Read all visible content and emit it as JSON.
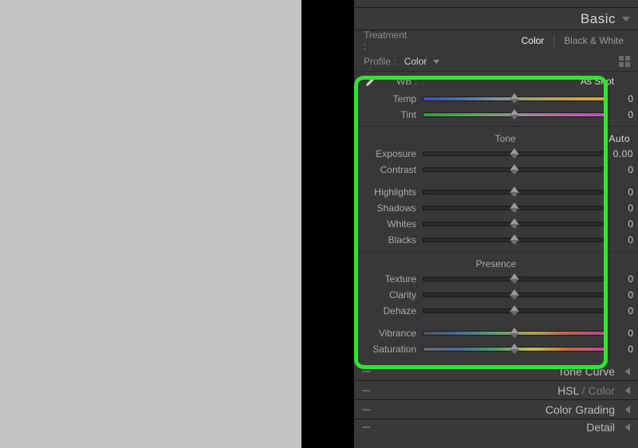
{
  "sections": {
    "basic": "Basic",
    "tone_curve": "Tone Curve",
    "hsl": "HSL",
    "hsl_suffix": " / Color",
    "color_grading": "Color Grading",
    "detail": "Detail"
  },
  "treatment": {
    "label": "Treatment :",
    "color": "Color",
    "bw": "Black & White"
  },
  "profile": {
    "label": "Profile :",
    "value": "Color"
  },
  "wb": {
    "label": "WB :",
    "preset": "As Shot",
    "temp_label": "Temp",
    "tint_label": "Tint",
    "temp_value": "0",
    "tint_value": "0"
  },
  "tone": {
    "title": "Tone",
    "auto": "Auto",
    "exposure_label": "Exposure",
    "exposure_value": "0.00",
    "contrast_label": "Contrast",
    "contrast_value": "0",
    "highlights_label": "Highlights",
    "highlights_value": "0",
    "shadows_label": "Shadows",
    "shadows_value": "0",
    "whites_label": "Whites",
    "whites_value": "0",
    "blacks_label": "Blacks",
    "blacks_value": "0"
  },
  "presence": {
    "title": "Presence",
    "texture_label": "Texture",
    "texture_value": "0",
    "clarity_label": "Clarity",
    "clarity_value": "0",
    "dehaze_label": "Dehaze",
    "dehaze_value": "0",
    "vibrance_label": "Vibrance",
    "vibrance_value": "0",
    "saturation_label": "Saturation",
    "saturation_value": "0"
  }
}
